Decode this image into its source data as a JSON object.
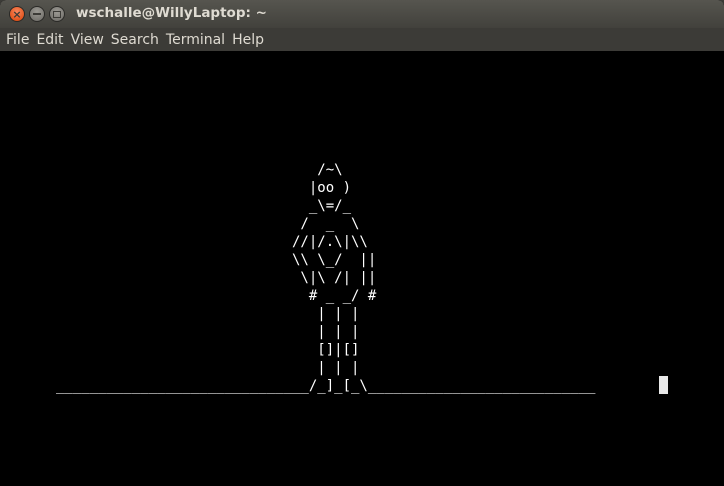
{
  "window": {
    "title": "wschalle@WillyLaptop: ~",
    "close_glyph": "×",
    "controls": [
      "close-icon",
      "minimize-icon",
      "maximize-icon"
    ]
  },
  "menubar": {
    "items": [
      "File",
      "Edit",
      "View",
      "Search",
      "Terminal",
      "Help"
    ]
  },
  "terminal": {
    "background": "#000000",
    "foreground": "#ffffff",
    "ascii_art": "                               /~\\\n                              |oo )\n                              _\\=/_\n                             /  _  \\\n                            //|/.\\|\\\\\n                            \\\\ \\_/  ||\n                             \\|\\ /| ||\n                              # _ _/ #\n                               | | |\n                               | | |\n                               []|[]\n                               | | |\n______________________________/_]_[_\\___________________________"
  }
}
